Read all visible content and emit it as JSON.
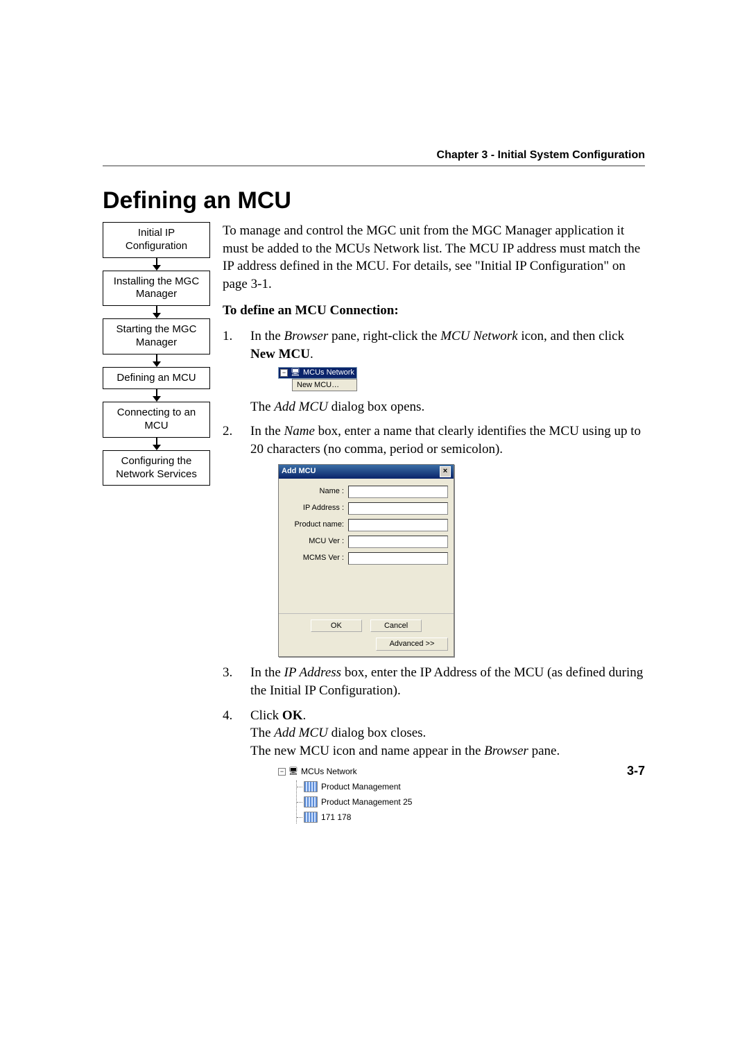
{
  "header": {
    "chapter": "Chapter 3 - Initial System Configuration"
  },
  "title": "Defining an MCU",
  "page_number": "3-7",
  "flow": {
    "boxes": [
      "Initial IP Configuration",
      "Installing the MGC Manager",
      "Starting the MGC Manager",
      "Defining an MCU",
      "Connecting to an MCU",
      "Configuring the Network Services"
    ]
  },
  "intro": "To manage and control the MGC unit from the MGC Manager application it must be added to the MCUs Network list. The MCU IP address must match the IP address defined in the MCU. For details, see \"Initial IP Configuration\" on page 3-1.",
  "instr_head": "To define an MCU Connection:",
  "steps": {
    "s1a": "In the ",
    "s1b": "Browser",
    "s1c": " pane, right-click the ",
    "s1d": "MCU Network",
    "s1e": " icon, and then click ",
    "s1f": "New MCU",
    "s1g": ".",
    "s1_after_a": "The ",
    "s1_after_b": "Add MCU",
    "s1_after_c": " dialog box opens.",
    "s2a": "In the ",
    "s2b": "Name",
    "s2c": " box, enter a name that clearly identifies the MCU using up to 20 characters (no comma, period or semicolon).",
    "s3a": "In the ",
    "s3b": "IP Address",
    "s3c": " box, enter the IP Address of the MCU (as defined during the Initial IP Configuration).",
    "s4a": "Click ",
    "s4b": "OK",
    "s4c": ".",
    "s4_after1a": "The ",
    "s4_after1b": "Add MCU",
    "s4_after1c": " dialog box closes.",
    "s4_after2a": "The new MCU icon and name appear in the ",
    "s4_after2b": "Browser",
    "s4_after2c": " pane."
  },
  "context_menu": {
    "root_label": "MCUs Network",
    "item": "New MCU…",
    "expander": "−"
  },
  "dialog": {
    "title": "Add MCU",
    "close": "×",
    "labels": {
      "name": "Name :",
      "ip": "IP Address :",
      "product": "Product name:",
      "mcu_ver": "MCU Ver :",
      "mcms_ver": "MCMS Ver :"
    },
    "buttons": {
      "ok": "OK",
      "cancel": "Cancel",
      "advanced": "Advanced >>"
    }
  },
  "tree": {
    "expander": "−",
    "root": "MCUs Network",
    "items": [
      "Product Management",
      "Product Management 25",
      "171 178"
    ]
  }
}
